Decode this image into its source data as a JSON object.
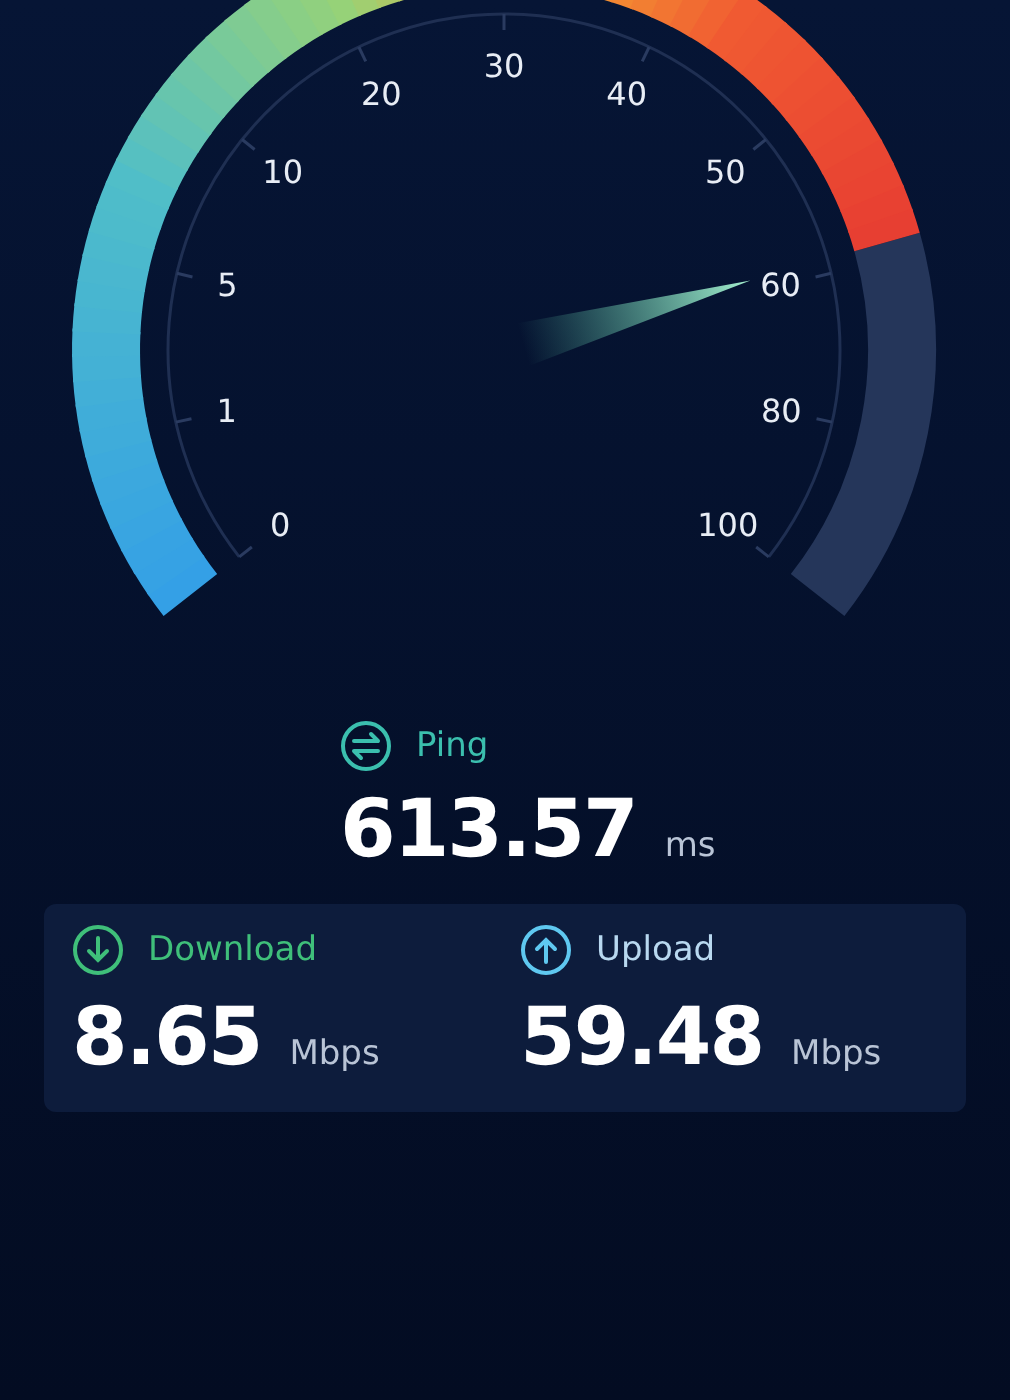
{
  "gauge": {
    "labels": [
      "0",
      "1",
      "5",
      "10",
      "20",
      "30",
      "40",
      "50",
      "60",
      "80",
      "100"
    ]
  },
  "ping": {
    "label": "Ping",
    "value": "613.57",
    "unit": "ms"
  },
  "results": [
    {
      "kind": "download",
      "label": "Download",
      "value": "8.65",
      "unit": "Mbps"
    },
    {
      "kind": "upload",
      "label": "Upload",
      "value": "59.48",
      "unit": "Mbps"
    }
  ]
}
